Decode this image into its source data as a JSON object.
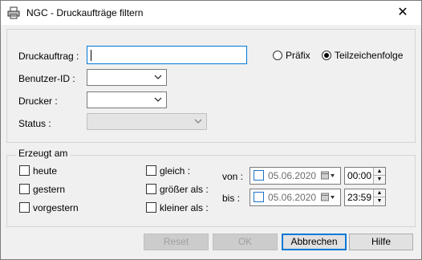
{
  "window": {
    "title": "NGC - Druckaufträge filtern",
    "close_glyph": "✕"
  },
  "filter": {
    "job_label": "Druckauftrag :",
    "job_value": "",
    "prefix_label": "Präfix",
    "substring_label": "Teilzeichenfolge",
    "match_mode": "Teilzeichenfolge",
    "user_label": "Benutzer-ID :",
    "user_value": "",
    "printer_label": "Drucker :",
    "printer_value": "",
    "status_label": "Status :",
    "status_value": ""
  },
  "created": {
    "legend": "Erzeugt am",
    "today_label": "heute",
    "yesterday_label": "gestern",
    "daybefore_label": "vorgestern",
    "equal_label": "gleich :",
    "greater_label": "größer als :",
    "less_label": "kleiner als :",
    "from_label": "von :",
    "to_label": "bis :",
    "from_date": "05.06.2020",
    "from_time": "00:00",
    "to_date": "05.06.2020",
    "to_time": "23:59"
  },
  "buttons": {
    "reset": "Reset",
    "ok": "OK",
    "cancel": "Abbrechen",
    "help": "Hilfe"
  },
  "colors": {
    "accent": "#0078d7",
    "checkbox_blue": "#1e72c6"
  }
}
